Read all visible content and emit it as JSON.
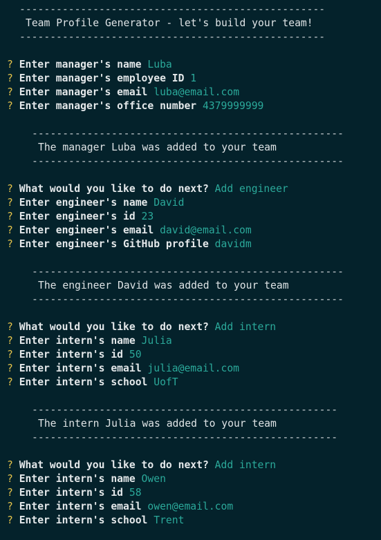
{
  "header": {
    "divider": "--------------------------------------------------",
    "title": "Team Profile Generator - let's build your team!"
  },
  "question_mark": "?",
  "divider_long": "---------------------------------------------------",
  "manager": [
    {
      "prompt": "Enter manager's name",
      "answer": "Luba"
    },
    {
      "prompt": "Enter manager's employee ID",
      "answer": "1"
    },
    {
      "prompt": "Enter manager's email",
      "answer": "luba@email.com"
    },
    {
      "prompt": "Enter manager's office number",
      "answer": "4379999999"
    }
  ],
  "manager_added": "The manager Luba was added to your team",
  "engineer": [
    {
      "prompt": "What would you like to do next?",
      "answer": "Add engineer"
    },
    {
      "prompt": "Enter engineer's name",
      "answer": "David"
    },
    {
      "prompt": "Enter engineer's id",
      "answer": "23"
    },
    {
      "prompt": "Enter engineer's email",
      "answer": "david@email.com"
    },
    {
      "prompt": "Enter engineer's GitHub profile",
      "answer": "davidm"
    }
  ],
  "engineer_added": "The engineer David was added to your team",
  "intern1": [
    {
      "prompt": "What would you like to do next?",
      "answer": "Add intern"
    },
    {
      "prompt": "Enter intern's name",
      "answer": "Julia"
    },
    {
      "prompt": "Enter intern's id",
      "answer": "50"
    },
    {
      "prompt": "Enter intern's email",
      "answer": "julia@email.com"
    },
    {
      "prompt": "Enter intern's school",
      "answer": "UofT"
    }
  ],
  "intern1_added": "The intern Julia was added to your team",
  "intern2": [
    {
      "prompt": "What would you like to do next?",
      "answer": "Add intern"
    },
    {
      "prompt": "Enter intern's name",
      "answer": "Owen"
    },
    {
      "prompt": "Enter intern's id",
      "answer": "58"
    },
    {
      "prompt": "Enter intern's email",
      "answer": "owen@email.com"
    },
    {
      "prompt": "Enter intern's school",
      "answer": "Trent"
    }
  ],
  "colors": {
    "background": "#04222b",
    "question_mark": "#e5c34b",
    "answer": "#2ba99a",
    "text": "#dfe4e6"
  }
}
